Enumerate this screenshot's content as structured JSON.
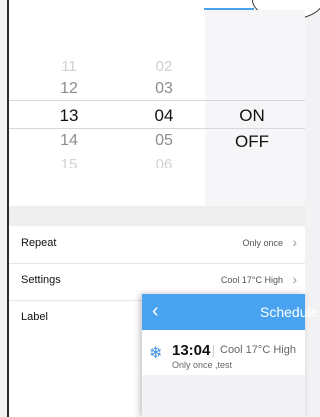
{
  "picker": {
    "hours": [
      "11",
      "12",
      "13",
      "14",
      "15"
    ],
    "minutes": [
      "02",
      "03",
      "04",
      "05",
      "06"
    ],
    "states": [
      "ON",
      "OFF"
    ]
  },
  "settings": {
    "rows": [
      {
        "label": "Repeat",
        "value": "Only once"
      },
      {
        "label": "Settings",
        "value": "Cool 17°C High"
      },
      {
        "label": "Label",
        "value": ""
      }
    ]
  },
  "overlay": {
    "title": "Schedule",
    "item": {
      "time": "13:04",
      "mode": "Cool 17°C High",
      "subtitle": "Only once ,test"
    }
  },
  "icons": {
    "back": "chevron-left-icon",
    "snow": "snowflake-icon",
    "chevron": "chevron-right-icon"
  },
  "colors": {
    "accent": "#4aa3f0"
  }
}
